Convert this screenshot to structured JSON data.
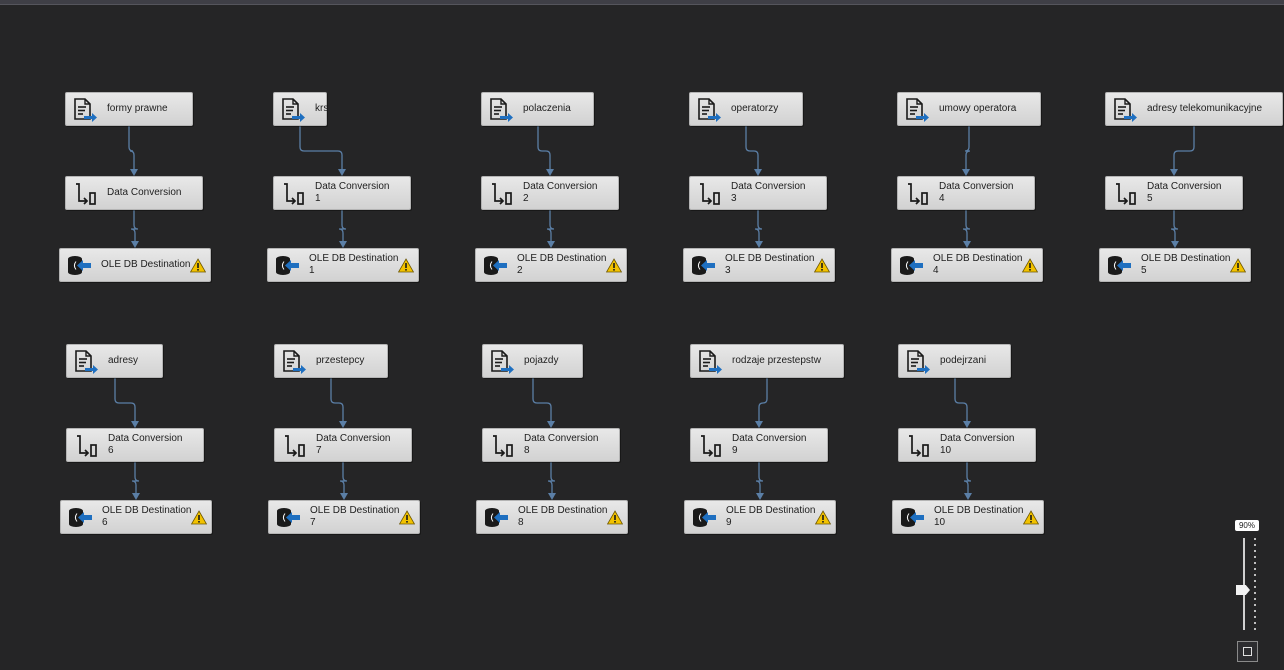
{
  "flows": [
    {
      "source": "formy prawne",
      "conversion": {
        "title": "Data Conversion",
        "index": ""
      },
      "destination": {
        "title": "OLE DB Destination",
        "index": ""
      }
    },
    {
      "source": "krs",
      "conversion": {
        "title": "Data Conversion",
        "index": "1"
      },
      "destination": {
        "title": "OLE DB Destination",
        "index": "1"
      }
    },
    {
      "source": "polaczenia",
      "conversion": {
        "title": "Data Conversion",
        "index": "2"
      },
      "destination": {
        "title": "OLE DB Destination",
        "index": "2"
      }
    },
    {
      "source": "operatorzy",
      "conversion": {
        "title": "Data Conversion",
        "index": "3"
      },
      "destination": {
        "title": "OLE DB Destination",
        "index": "3"
      }
    },
    {
      "source": "umowy operatora",
      "conversion": {
        "title": "Data Conversion",
        "index": "4"
      },
      "destination": {
        "title": "OLE DB Destination",
        "index": "4"
      }
    },
    {
      "source": "adresy telekomunikacyjne",
      "conversion": {
        "title": "Data Conversion",
        "index": "5"
      },
      "destination": {
        "title": "OLE DB Destination",
        "index": "5"
      }
    },
    {
      "source": "adresy",
      "conversion": {
        "title": "Data Conversion",
        "index": "6"
      },
      "destination": {
        "title": "OLE DB Destination",
        "index": "6"
      }
    },
    {
      "source": "przestepcy",
      "conversion": {
        "title": "Data Conversion",
        "index": "7"
      },
      "destination": {
        "title": "OLE DB Destination",
        "index": "7"
      }
    },
    {
      "source": "pojazdy",
      "conversion": {
        "title": "Data Conversion",
        "index": "8"
      },
      "destination": {
        "title": "OLE DB Destination",
        "index": "8"
      }
    },
    {
      "source": "rodzaje przestepstw",
      "conversion": {
        "title": "Data Conversion",
        "index": "9"
      },
      "destination": {
        "title": "OLE DB Destination",
        "index": "9"
      }
    },
    {
      "source": "podejrzani",
      "conversion": {
        "title": "Data Conversion",
        "index": "10"
      },
      "destination": {
        "title": "OLE DB Destination",
        "index": "10"
      }
    }
  ],
  "destination_status": "warning",
  "zoom": {
    "label": "90%",
    "level_percent": 90
  },
  "colors": {
    "canvas": "#252526",
    "connector": "#5b7fa6",
    "node_fill": "#dcdcdc",
    "icon_blue": "#1e6fc0",
    "warning": "#f2c200"
  },
  "icons": {
    "source": "flat-file-source-icon",
    "conversion": "data-conversion-icon",
    "destination": "ole-db-destination-icon",
    "warning": "warning-icon"
  }
}
